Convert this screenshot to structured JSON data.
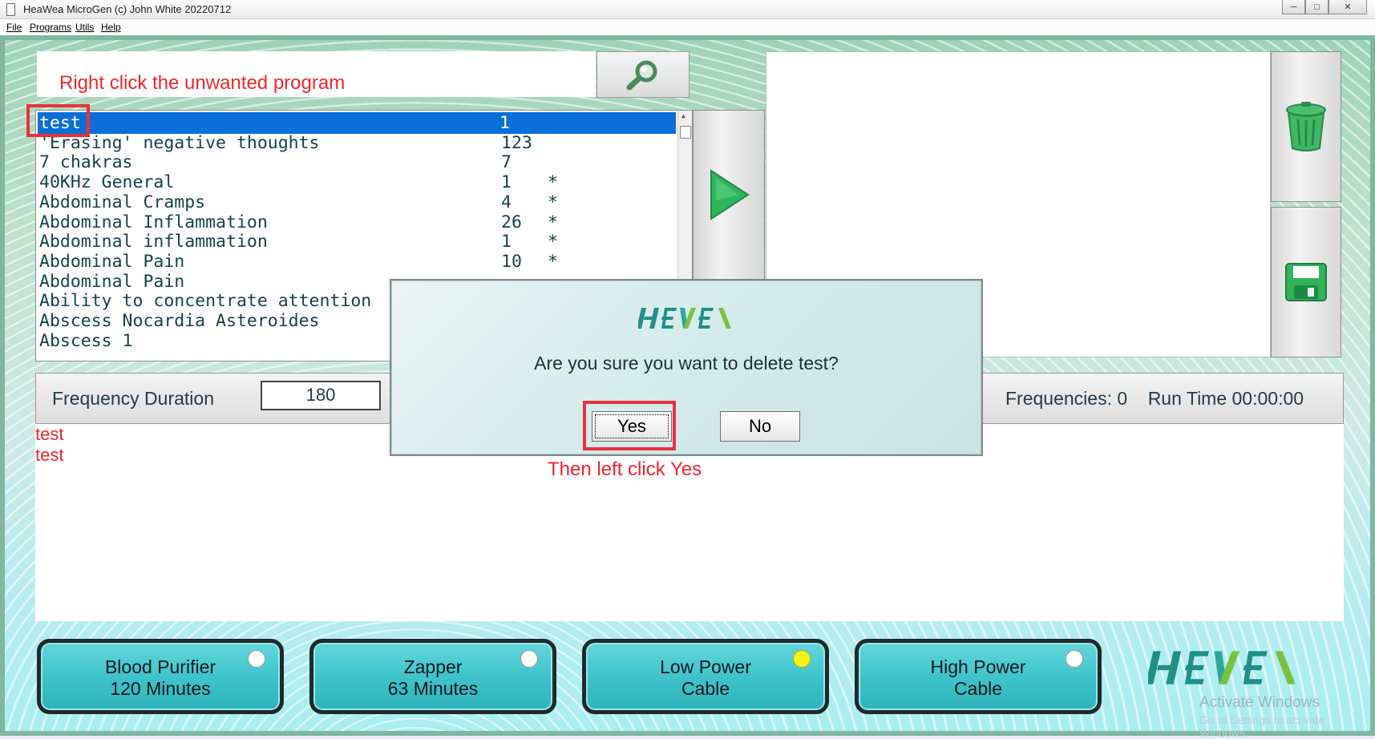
{
  "window": {
    "title": "HeaWea MicroGen (c) John White 20220712",
    "minimize": "─",
    "maximize": "□",
    "close": "✕"
  },
  "menu": {
    "file": "File",
    "programs": "Programs",
    "utils": "Utils",
    "help": "Help"
  },
  "hints": {
    "top": "Right click the unwanted program",
    "bottom": "Then left click Yes"
  },
  "program_list": [
    {
      "name": "test",
      "count": "1",
      "star": "",
      "selected": true
    },
    {
      "name": "'Erasing' negative thoughts",
      "count": "123",
      "star": ""
    },
    {
      "name": "7 chakras",
      "count": "7",
      "star": ""
    },
    {
      "name": "40KHz General",
      "count": "1",
      "star": "*"
    },
    {
      "name": "Abdominal Cramps",
      "count": "4",
      "star": "*"
    },
    {
      "name": "Abdominal Inflammation",
      "count": "26",
      "star": "*"
    },
    {
      "name": "Abdominal inflammation",
      "count": "1",
      "star": "*"
    },
    {
      "name": "Abdominal Pain",
      "count": "10",
      "star": "*"
    },
    {
      "name": "Abdominal Pain",
      "count": "",
      "star": ""
    },
    {
      "name": "Ability to concentrate attention",
      "count": "",
      "star": ""
    },
    {
      "name": "Abscess Nocardia Asteroides",
      "count": "",
      "star": ""
    },
    {
      "name": "Abscess 1",
      "count": "",
      "star": ""
    }
  ],
  "frequency": {
    "label": "Frequency Duration",
    "duration_value": "180",
    "stats": "Frequencies: 0    Run Time 00:00:00"
  },
  "output_lines": [
    "test",
    "test"
  ],
  "dialog": {
    "message": "Are you sure you want to delete test?",
    "yes": "Yes",
    "no": "No"
  },
  "bottom_buttons": [
    {
      "line1": "Blood Purifier",
      "line2": "120 Minutes",
      "indicator": "off"
    },
    {
      "line1": "Zapper",
      "line2": "63 Minutes",
      "indicator": "off"
    },
    {
      "line1": "Low Power",
      "line2": "Cable",
      "indicator": "on"
    },
    {
      "line1": "High Power",
      "line2": "Cable",
      "indicator": "off"
    }
  ],
  "watermark": {
    "line1": "Activate Windows",
    "line2": "Go to Settings to activate Windows."
  },
  "icons": [
    "search-icon",
    "play-icon",
    "trash-icon",
    "save-icon",
    "heawea-logo"
  ],
  "colors": {
    "selection": "#0a6fd8",
    "hint_red": "#f0262b",
    "button_teal": "#3fc4cb",
    "indicator_on": "#f4f21a"
  }
}
